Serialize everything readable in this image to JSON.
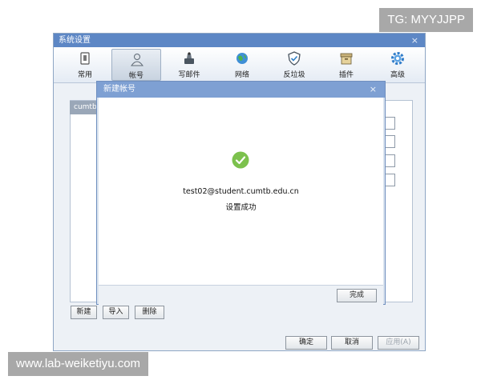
{
  "watermarks": {
    "top": "TG: MYYJJPP",
    "bottom": "www.lab-weiketiyu.com"
  },
  "settings_window": {
    "title": "系统设置",
    "close": "×",
    "toolbar": [
      {
        "label": "常用",
        "icon": "general-icon"
      },
      {
        "label": "帐号",
        "icon": "account-icon",
        "active": true
      },
      {
        "label": "写邮件",
        "icon": "compose-icon"
      },
      {
        "label": "网络",
        "icon": "network-icon"
      },
      {
        "label": "反垃圾",
        "icon": "antispam-icon"
      },
      {
        "label": "插件",
        "icon": "plugin-icon"
      },
      {
        "label": "高级",
        "icon": "advanced-icon"
      }
    ],
    "account_list": [
      "cumtb"
    ],
    "list_buttons": {
      "new": "新建",
      "import": "导入",
      "delete": "删除"
    },
    "footer_buttons": {
      "ok": "确定",
      "cancel": "取消",
      "apply": "应用(A)"
    }
  },
  "modal": {
    "title": "新建帐号",
    "close": "×",
    "email": "test02@student.cumtb.edu.cn",
    "status": "设置成功",
    "finish": "完成"
  },
  "colors": {
    "titlebar": "#5d87c5",
    "modal_titlebar": "#7ea0d3",
    "success": "#7cc14d"
  }
}
